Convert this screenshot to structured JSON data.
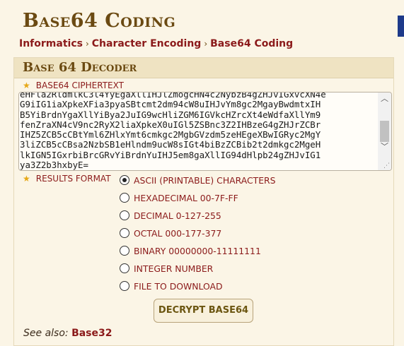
{
  "page": {
    "title": "Base64 Coding",
    "breadcrumb": [
      "Informatics",
      "Character Encoding",
      "Base64 Coding"
    ],
    "separator": "›"
  },
  "panel": {
    "title": "Base 64 Decoder",
    "ciphertext_label": "BASE64 CIPHERTEXT",
    "ciphertext_lines": [
      "eHFla2RldmlkC3l4YyEgaXllIHJlZmogcHN4c2NybzB4gZHJvIGxvcXN4e",
      "G9iIG1iaXpkeXFia3pyaSBtcmt2dm94cW8uIHJvYm8gc2MgayBwdmtxIH",
      "B5YiBrdnYgaXllYiBya2JuIG9wcHliZGM6IGVkcHZrcXt4eWdfaXllYm9",
      "fenZraXN4cV9nc2RyX2liaXpkeX0uIGl5ZSBnc3Z2IHBzeG4gZHJrZCBr",
      "IHZ5ZCB5cCBtYml6ZHlxYmt6cmkgc2MgbGVzdm5zeHEgeXBwIGRyc2MgY",
      "3liZCB5cCBsa2NzbSB1eHlndm9ucW8sIGt4biBzZCBib2t2dmkgc2MgeH",
      "lkIGN5IGxrbiBrcGRvYiBrdnYuIHJ5em8gaXllIG94dHlpb24gZHJvIG1",
      "ya3Z2b3hxbyE="
    ],
    "results_label": "RESULTS FORMAT",
    "formats": [
      {
        "label": "ASCII (PRINTABLE) CHARACTERS",
        "checked": true
      },
      {
        "label": "HEXADECIMAL 00-7F-FF",
        "checked": false
      },
      {
        "label": "DECIMAL 0-127-255",
        "checked": false
      },
      {
        "label": "OCTAL 000-177-377",
        "checked": false
      },
      {
        "label": "BINARY 00000000-11111111",
        "checked": false
      },
      {
        "label": "INTEGER NUMBER",
        "checked": false
      },
      {
        "label": "FILE TO DOWNLOAD",
        "checked": false
      }
    ],
    "decrypt_label": "DECRYPT BASE64",
    "see_also_label": "See also:",
    "see_also_link": "Base32"
  },
  "icons": {
    "star": "star-icon",
    "up": "scroll-up-arrow-icon",
    "down": "scroll-down-arrow-icon",
    "resize": "resize-grip-icon"
  },
  "colors": {
    "accent": "#8b1a1a",
    "title": "#6b4a12",
    "background": "#fbf5e6",
    "header": "#efe3c2",
    "star": "#e6a817"
  }
}
